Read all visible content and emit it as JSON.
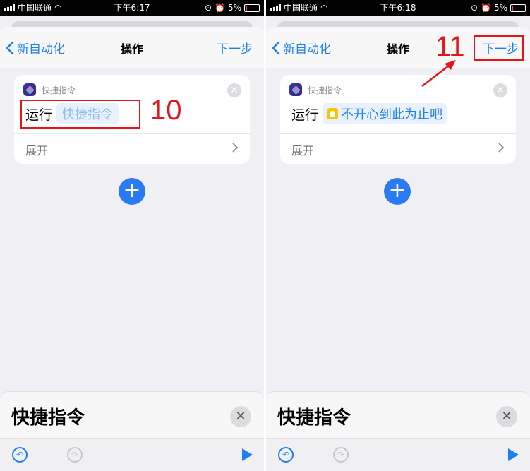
{
  "left": {
    "status": {
      "carrier": "中国联通",
      "time": "下午6:17",
      "battery": "5%"
    },
    "nav": {
      "back_label": "新自动化",
      "title": "操作",
      "next_label": "下一步"
    },
    "card": {
      "app_name": "快捷指令",
      "run_label": "运行",
      "param": "快捷指令",
      "expand_label": "展开"
    },
    "bottom": {
      "title": "快捷指令"
    },
    "annotation": {
      "step": "10"
    }
  },
  "right": {
    "status": {
      "carrier": "中国联通",
      "time": "下午6:18",
      "battery": "5%"
    },
    "nav": {
      "back_label": "新自动化",
      "title": "操作",
      "next_label": "下一步"
    },
    "card": {
      "app_name": "快捷指令",
      "run_label": "运行",
      "param": "不开心到此为止吧",
      "expand_label": "展开"
    },
    "bottom": {
      "title": "快捷指令"
    },
    "annotation": {
      "step": "11"
    }
  },
  "colors": {
    "accent": "#1f7ff0",
    "annotation": "#e3151a",
    "add_button": "#2a7bf2"
  },
  "icons": {
    "back": "chevron-left-icon",
    "close": "close-icon",
    "expand": "chevron-right-icon",
    "undo": "undo-icon",
    "redo": "redo-icon",
    "play": "play-icon",
    "add": "plus-icon",
    "shortcut": "bell-icon"
  }
}
